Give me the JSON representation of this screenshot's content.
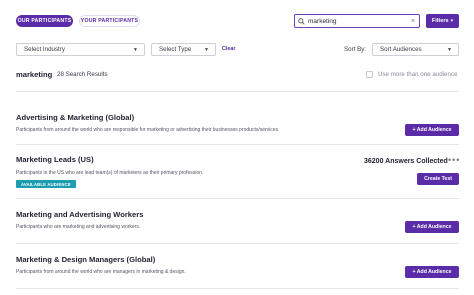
{
  "tabs": {
    "our_participants": "OUR PARTICIPANTS",
    "your_participants": "YOUR PARTICIPANTS"
  },
  "search": {
    "value": "marketing",
    "icon": "search-icon",
    "clear_glyph": "×"
  },
  "filters_button": "Filters",
  "filters_caret": "▾",
  "filters": {
    "industry": "Select Industry",
    "type": "Select Type",
    "clear": "Clear",
    "sort_label": "Sort By:",
    "sort_value": "Sort Audiences",
    "caret": "▼"
  },
  "results": {
    "query": "marketing",
    "count_text": "28 Search Results",
    "multi_audience_label": "Use more than one audience"
  },
  "audiences": [
    {
      "title": "Advertising & Marketing (Global)",
      "description": "Participants from around the world who are responsible for marketing or advertising their businesses products/services.",
      "action": "+ Add Audience"
    },
    {
      "title": "Marketing Leads (US)",
      "description": "Participants in the US who are lead team(s) of marketers as their primary profession.",
      "badge": "AVAILABLE AUDIENCE",
      "answers": "36200 Answers Collected",
      "more": "•••",
      "action": "Create Test"
    },
    {
      "title": "Marketing and Advertising Workers",
      "description": "Participants who are marketing and advertising workers.",
      "action": "+ Add Audience"
    },
    {
      "title": "Marketing & Design Managers (Global)",
      "description": "Participants from around the world who are managers in marketing & design.",
      "action": "+ Add Audience"
    }
  ],
  "colors": {
    "accent": "#5b2ca8",
    "badge": "#1e9db1"
  }
}
